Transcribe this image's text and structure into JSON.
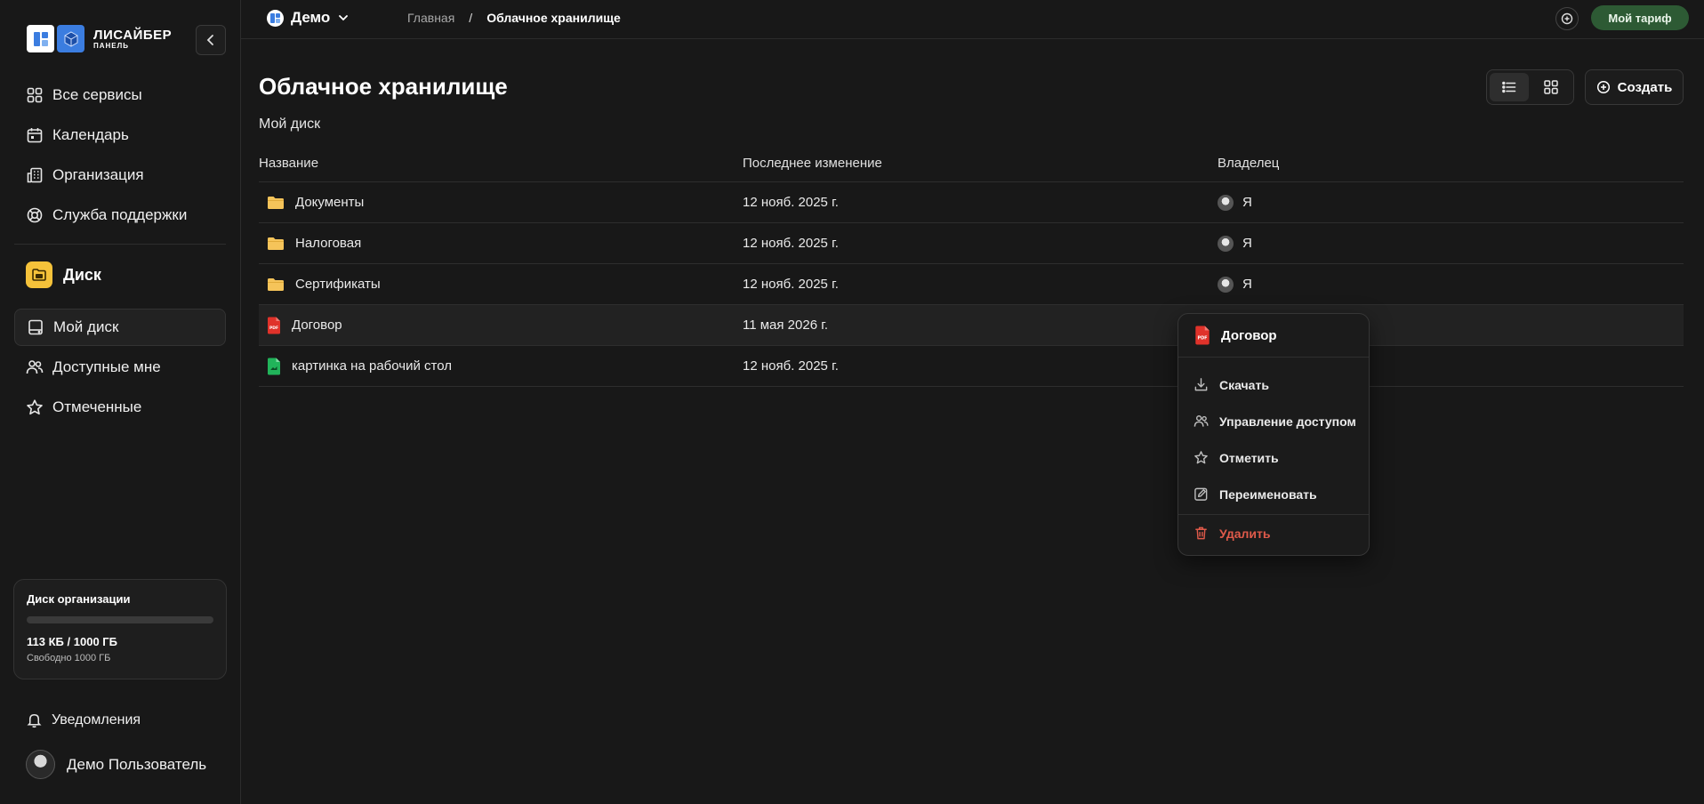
{
  "app": {
    "logo_name": "ЛИСАЙБЕР",
    "logo_sub": "ПАНЕЛЬ"
  },
  "sidebar": {
    "items": [
      {
        "label": "Все сервисы",
        "icon": "grid-icon"
      },
      {
        "label": "Календарь",
        "icon": "calendar-icon"
      },
      {
        "label": "Организация",
        "icon": "building-icon"
      },
      {
        "label": "Служба поддержки",
        "icon": "lifebuoy-icon"
      }
    ],
    "section_title": "Диск",
    "disk_items": [
      {
        "label": "Мой диск",
        "icon": "hard-drive-icon",
        "active": true
      },
      {
        "label": "Доступные мне",
        "icon": "users-icon"
      },
      {
        "label": "Отмеченные",
        "icon": "star-icon"
      }
    ],
    "storage": {
      "title": "Диск организации",
      "used": "113 КБ",
      "separator": "/",
      "total": "1000 ГБ",
      "free": "Свободно 1000 ГБ",
      "fill_fraction": 0.0
    },
    "notifications_label": "Уведомления",
    "user_name": "Демо Пользователь"
  },
  "topbar": {
    "org_name": "Демо",
    "breadcrumb_home": "Главная",
    "breadcrumb_sep": "/",
    "breadcrumb_current": "Облачное хранилище",
    "plan_label": "Мой тариф"
  },
  "main": {
    "title": "Облачное хранилище",
    "section_label": "Мой диск",
    "create_label": "Создать",
    "columns": {
      "name": "Название",
      "modified": "Последнее изменение",
      "owner": "Владелец"
    },
    "rows": [
      {
        "name": "Документы",
        "type": "folder",
        "modified": "12 нояб. 2025 г.",
        "owner": "Я"
      },
      {
        "name": "Налоговая",
        "type": "folder",
        "modified": "12 нояб. 2025 г.",
        "owner": "Я"
      },
      {
        "name": "Сертификаты",
        "type": "folder",
        "modified": "12 нояб. 2025 г.",
        "owner": "Я"
      },
      {
        "name": "Договор",
        "type": "pdf",
        "modified": "11 мая 2026 г.",
        "owner": ""
      },
      {
        "name": "картинка на рабочий стол",
        "type": "image",
        "modified": "12 нояб. 2025 г.",
        "owner": ""
      }
    ]
  },
  "context_menu": {
    "title": "Договор",
    "items": [
      {
        "label": "Скачать",
        "icon": "download-icon"
      },
      {
        "label": "Управление доступом",
        "icon": "users-icon"
      },
      {
        "label": "Отметить",
        "icon": "star-icon"
      },
      {
        "label": "Переименовать",
        "icon": "rename-icon"
      }
    ],
    "danger": {
      "label": "Удалить",
      "icon": "trash-icon"
    }
  },
  "colors": {
    "background": "#181818",
    "plan_button": "#2d5a34",
    "disk_badge": "#f5c23a",
    "pdf_red": "#e0322a",
    "image_green": "#21b45a",
    "folder_yellow": "#f5c45a",
    "danger": "#e05a4a"
  }
}
